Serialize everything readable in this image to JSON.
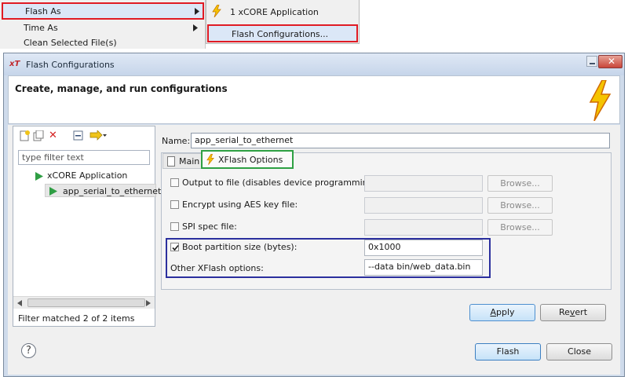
{
  "context_menu": {
    "items": [
      {
        "label": "Flash As",
        "has_submenu": true
      },
      {
        "label": "Time As",
        "has_submenu": true
      },
      {
        "label": "Clean Selected File(s)",
        "has_submenu": false
      }
    ],
    "submenu": [
      {
        "label": "1 xCORE Application"
      },
      {
        "label": "Flash Configurations..."
      }
    ]
  },
  "dialog": {
    "title": "Flash Configurations",
    "title_icon": "xT",
    "header_title": "Create, manage, and run configurations",
    "filter_placeholder": "type filter text",
    "tree": {
      "category": "xCORE Application",
      "item": "app_serial_to_ethernet_"
    },
    "filter_status": "Filter matched 2 of 2 items",
    "name_label": "Name:",
    "name_value": "app_serial_to_ethernet",
    "tabs": [
      {
        "label": "Main",
        "active": false
      },
      {
        "label": "XFlash Options",
        "active": true
      }
    ],
    "options": [
      {
        "label": "Output to file (disables device programming):",
        "checked": false,
        "enabled": false,
        "value": "",
        "browse": "Browse..."
      },
      {
        "label": "Encrypt using AES key file:",
        "checked": false,
        "enabled": false,
        "value": "",
        "browse": "Browse..."
      },
      {
        "label": "SPI spec file:",
        "checked": false,
        "enabled": false,
        "value": "",
        "browse": "Browse..."
      },
      {
        "label": "Boot partition size (bytes):",
        "checked": true,
        "enabled": true,
        "value": "0x1000"
      }
    ],
    "other_options_label": "Other XFlash options:",
    "other_options_value": "--data bin/web_data.bin",
    "apply_label": "Apply",
    "revert_label": "Revert",
    "flash_label": "Flash",
    "close_label": "Close",
    "help_glyph": "?"
  },
  "colors": {
    "highlight_red": "#e01b24",
    "highlight_green": "#2ea043",
    "highlight_blue": "#2b2f9e",
    "bolt_yellow": "#f5c400",
    "bolt_orange": "#e07b00"
  }
}
